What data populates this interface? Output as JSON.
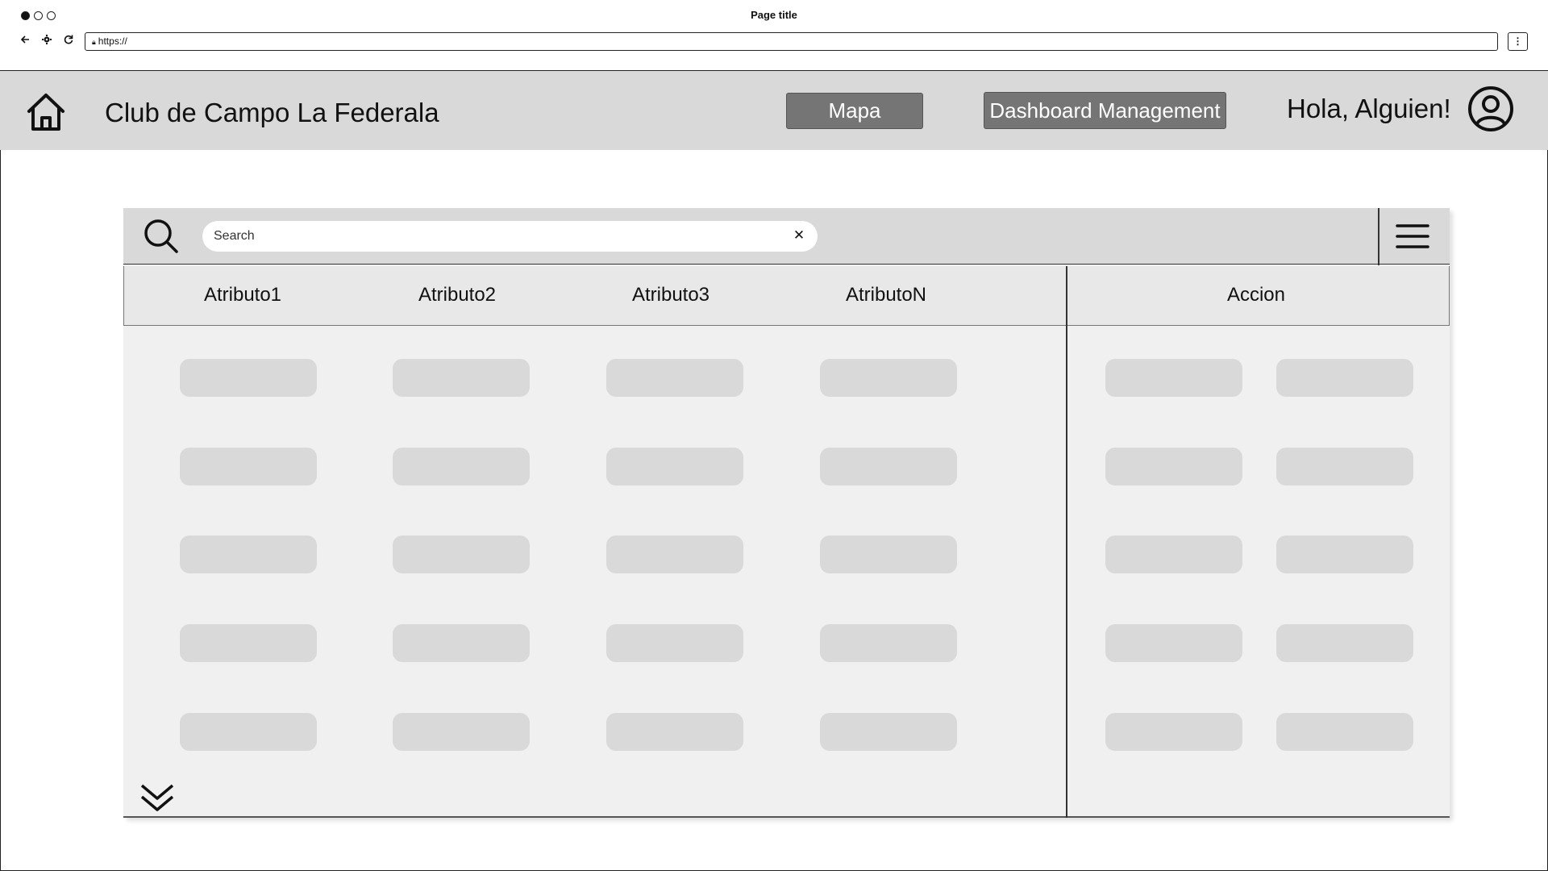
{
  "browser": {
    "page_title": "Page title",
    "url": "https://",
    "back_icon": "back-arrow-icon",
    "settings_icon": "gear-icon",
    "reload_icon": "reload-icon",
    "menu_glyph": "⋮"
  },
  "header": {
    "app_title": "Club de Campo La Federala",
    "nav": {
      "mapa_label": "Mapa",
      "dashboard_label": "Dashboard Management"
    },
    "greeting": "Hola, Alguien!"
  },
  "toolbar": {
    "search_placeholder": "Search",
    "clear_glyph": "✕"
  },
  "table": {
    "columns": [
      "Atributo1",
      "Atributo2",
      "Atributo3",
      "AtributoN"
    ],
    "action_column": "Accion",
    "row_count": 5,
    "action_buttons_per_row": 2
  },
  "colors": {
    "header_bg": "#d9d9d9",
    "button_bg": "#757575",
    "panel_bg": "#f0f0f0",
    "placeholder_cell": "#d9d9d9"
  }
}
